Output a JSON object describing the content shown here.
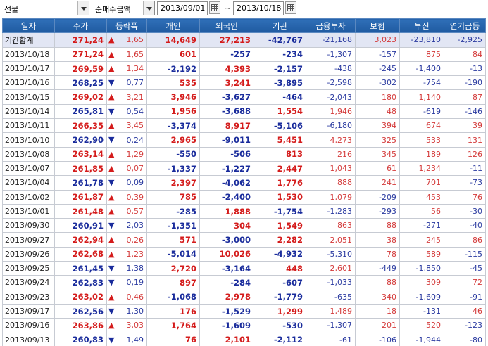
{
  "toolbar": {
    "market_select": "선물",
    "metric_select": "순매수금액",
    "date_from": "2013/09/01",
    "date_to": "2013/10/18",
    "range_separator": "~"
  },
  "columns": [
    "일자",
    "주가",
    "등락폭",
    "개인",
    "외국인",
    "기관",
    "금융투자",
    "보험",
    "투신",
    "연기금등"
  ],
  "colors": {
    "up": "#d41b1b",
    "down": "#1a2c9c",
    "header_bg": "#2468b0",
    "summary_bg": "#e2e6f4"
  },
  "rows": [
    {
      "date": "기간합계",
      "price": "271,24",
      "dir": "up",
      "diff": "1,65",
      "ind": "14,649",
      "frn": "27,213",
      "inst": "-42,767",
      "fin": "-21,168",
      "ins": "3,023",
      "trust": "-23,810",
      "pens": "-2,925",
      "summary": true
    },
    {
      "date": "2013/10/18",
      "price": "271,24",
      "dir": "up",
      "diff": "1,65",
      "ind": "601",
      "frn": "-257",
      "inst": "-234",
      "fin": "-1,307",
      "ins": "-157",
      "trust": "875",
      "pens": "84"
    },
    {
      "date": "2013/10/17",
      "price": "269,59",
      "dir": "up",
      "diff": "1,34",
      "ind": "-2,192",
      "frn": "4,393",
      "inst": "-2,157",
      "fin": "-438",
      "ins": "-245",
      "trust": "-1,400",
      "pens": "-13"
    },
    {
      "date": "2013/10/16",
      "price": "268,25",
      "dir": "down",
      "diff": "0,77",
      "ind": "535",
      "frn": "3,241",
      "inst": "-3,895",
      "fin": "-2,598",
      "ins": "-302",
      "trust": "-754",
      "pens": "-190"
    },
    {
      "date": "2013/10/15",
      "price": "269,02",
      "dir": "up",
      "diff": "3,21",
      "ind": "3,946",
      "frn": "-3,627",
      "inst": "-464",
      "fin": "-2,043",
      "ins": "180",
      "trust": "1,140",
      "pens": "87"
    },
    {
      "date": "2013/10/14",
      "price": "265,81",
      "dir": "down",
      "diff": "0,54",
      "ind": "1,956",
      "frn": "-3,688",
      "inst": "1,554",
      "fin": "1,946",
      "ins": "48",
      "trust": "-619",
      "pens": "-146"
    },
    {
      "date": "2013/10/11",
      "price": "266,35",
      "dir": "up",
      "diff": "3,45",
      "ind": "-3,374",
      "frn": "8,917",
      "inst": "-5,106",
      "fin": "-6,180",
      "ins": "394",
      "trust": "674",
      "pens": "39"
    },
    {
      "date": "2013/10/10",
      "price": "262,90",
      "dir": "down",
      "diff": "0,24",
      "ind": "2,965",
      "frn": "-9,011",
      "inst": "5,451",
      "fin": "4,273",
      "ins": "325",
      "trust": "533",
      "pens": "131"
    },
    {
      "date": "2013/10/08",
      "price": "263,14",
      "dir": "up",
      "diff": "1,29",
      "ind": "-550",
      "frn": "-506",
      "inst": "813",
      "fin": "216",
      "ins": "345",
      "trust": "189",
      "pens": "126"
    },
    {
      "date": "2013/10/07",
      "price": "261,85",
      "dir": "up",
      "diff": "0,07",
      "ind": "-1,337",
      "frn": "-1,227",
      "inst": "2,447",
      "fin": "1,043",
      "ins": "61",
      "trust": "1,234",
      "pens": "-11"
    },
    {
      "date": "2013/10/04",
      "price": "261,78",
      "dir": "down",
      "diff": "0,09",
      "ind": "2,397",
      "frn": "-4,062",
      "inst": "1,776",
      "fin": "888",
      "ins": "241",
      "trust": "701",
      "pens": "-73"
    },
    {
      "date": "2013/10/02",
      "price": "261,87",
      "dir": "up",
      "diff": "0,39",
      "ind": "785",
      "frn": "-2,400",
      "inst": "1,530",
      "fin": "1,079",
      "ins": "-209",
      "trust": "453",
      "pens": "76"
    },
    {
      "date": "2013/10/01",
      "price": "261,48",
      "dir": "up",
      "diff": "0,57",
      "ind": "-285",
      "frn": "1,888",
      "inst": "-1,754",
      "fin": "-1,283",
      "ins": "-293",
      "trust": "56",
      "pens": "-30"
    },
    {
      "date": "2013/09/30",
      "price": "260,91",
      "dir": "down",
      "diff": "2,03",
      "ind": "-1,351",
      "frn": "304",
      "inst": "1,549",
      "fin": "863",
      "ins": "88",
      "trust": "-271",
      "pens": "-40"
    },
    {
      "date": "2013/09/27",
      "price": "262,94",
      "dir": "up",
      "diff": "0,26",
      "ind": "571",
      "frn": "-3,000",
      "inst": "2,282",
      "fin": "2,051",
      "ins": "38",
      "trust": "245",
      "pens": "86"
    },
    {
      "date": "2013/09/26",
      "price": "262,68",
      "dir": "up",
      "diff": "1,23",
      "ind": "-5,014",
      "frn": "10,026",
      "inst": "-4,932",
      "fin": "-5,310",
      "ins": "78",
      "trust": "589",
      "pens": "-115"
    },
    {
      "date": "2013/09/25",
      "price": "261,45",
      "dir": "down",
      "diff": "1,38",
      "ind": "2,720",
      "frn": "-3,164",
      "inst": "448",
      "fin": "2,601",
      "ins": "-449",
      "trust": "-1,850",
      "pens": "-45"
    },
    {
      "date": "2013/09/24",
      "price": "262,83",
      "dir": "down",
      "diff": "0,19",
      "ind": "897",
      "frn": "-284",
      "inst": "-607",
      "fin": "-1,033",
      "ins": "88",
      "trust": "309",
      "pens": "72"
    },
    {
      "date": "2013/09/23",
      "price": "263,02",
      "dir": "up",
      "diff": "0,46",
      "ind": "-1,068",
      "frn": "2,978",
      "inst": "-1,779",
      "fin": "-635",
      "ins": "340",
      "trust": "-1,609",
      "pens": "-91"
    },
    {
      "date": "2013/09/17",
      "price": "262,56",
      "dir": "down",
      "diff": "1,30",
      "ind": "176",
      "frn": "-1,529",
      "inst": "1,299",
      "fin": "1,489",
      "ins": "18",
      "trust": "-131",
      "pens": "46"
    },
    {
      "date": "2013/09/16",
      "price": "263,86",
      "dir": "up",
      "diff": "3,03",
      "ind": "1,764",
      "frn": "-1,609",
      "inst": "-530",
      "fin": "-1,307",
      "ins": "201",
      "trust": "520",
      "pens": "-123"
    },
    {
      "date": "2013/09/13",
      "price": "260,83",
      "dir": "down",
      "diff": "1,49",
      "ind": "76",
      "frn": "2,101",
      "inst": "-2,112",
      "fin": "-61",
      "ins": "-106",
      "trust": "-1,944",
      "pens": "-80"
    }
  ]
}
